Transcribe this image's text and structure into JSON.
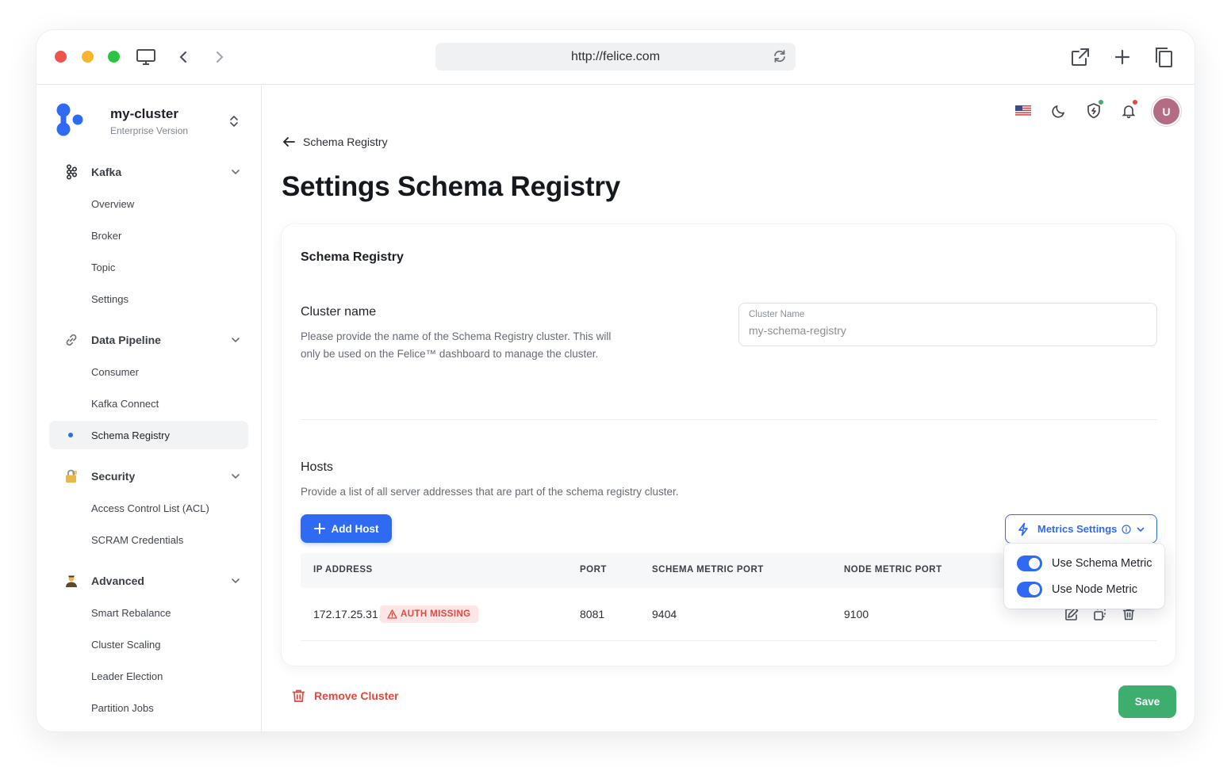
{
  "browser": {
    "url": "http://felice.com"
  },
  "sidebar": {
    "cluster": {
      "name": "my-cluster",
      "version": "Enterprise Version"
    },
    "groups": [
      {
        "label": "Kafka",
        "items": [
          "Overview",
          "Broker",
          "Topic",
          "Settings"
        ]
      },
      {
        "label": "Data Pipeline",
        "items": [
          "Consumer",
          "Kafka Connect",
          "Schema Registry"
        ]
      },
      {
        "label": "Security",
        "items": [
          "Access Control List (ACL)",
          "SCRAM Credentials"
        ]
      },
      {
        "label": "Advanced",
        "items": [
          "Smart Rebalance",
          "Cluster Scaling",
          "Leader Election",
          "Partition Jobs"
        ]
      }
    ],
    "active_item": "Schema Registry"
  },
  "topbar": {
    "avatar_initial": "U",
    "shield_status_color": "#3eae6e",
    "notification_color": "#e1483f"
  },
  "breadcrumb": {
    "back_label": "Schema Registry"
  },
  "page": {
    "title": "Settings Schema Registry"
  },
  "card": {
    "title": "Schema Registry",
    "cluster_name": {
      "heading": "Cluster name",
      "description": "Please provide the name of the Schema Registry cluster. This will only be used on the Felice™ dashboard to manage the cluster.",
      "field_label": "Cluster Name",
      "field_value": "my-schema-registry"
    },
    "hosts": {
      "heading": "Hosts",
      "description": "Provide a list of all server addresses that are part of the schema registry cluster.",
      "add_label": "Add Host",
      "metrics_label": "Metrics Settings",
      "columns": [
        "IP ADDRESS",
        "PORT",
        "SCHEMA METRIC PORT",
        "NODE METRIC PORT"
      ],
      "rows": [
        {
          "ip": "172.17.25.31",
          "badge": "AUTH MISSING",
          "port": "8081",
          "schema_metric_port": "9404",
          "node_metric_port": "9100"
        }
      ]
    },
    "metrics_menu": {
      "options": [
        {
          "label": "Use Schema Metric",
          "enabled": true
        },
        {
          "label": "Use Node Metric",
          "enabled": true
        }
      ]
    }
  },
  "footer": {
    "remove_label": "Remove Cluster",
    "save_label": "Save"
  },
  "colors": {
    "primary": "#2f6af3",
    "danger": "#e1483f",
    "success": "#3eae6e"
  }
}
